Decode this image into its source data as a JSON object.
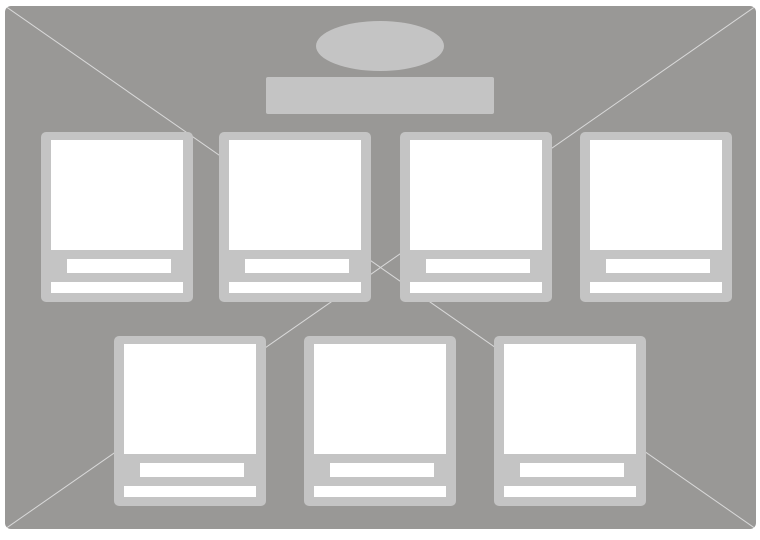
{
  "wireframe": {
    "placeholder_logo": "",
    "placeholder_banner": "",
    "cards": [
      {
        "caption": "",
        "subcaption": ""
      },
      {
        "caption": "",
        "subcaption": ""
      },
      {
        "caption": "",
        "subcaption": ""
      },
      {
        "caption": "",
        "subcaption": ""
      },
      {
        "caption": "",
        "subcaption": ""
      },
      {
        "caption": "",
        "subcaption": ""
      },
      {
        "caption": "",
        "subcaption": ""
      }
    ]
  },
  "colors": {
    "background": "#999896",
    "placeholder": "#c4c4c4",
    "content": "#ffffff",
    "diagonal": "#d9d9d9"
  }
}
